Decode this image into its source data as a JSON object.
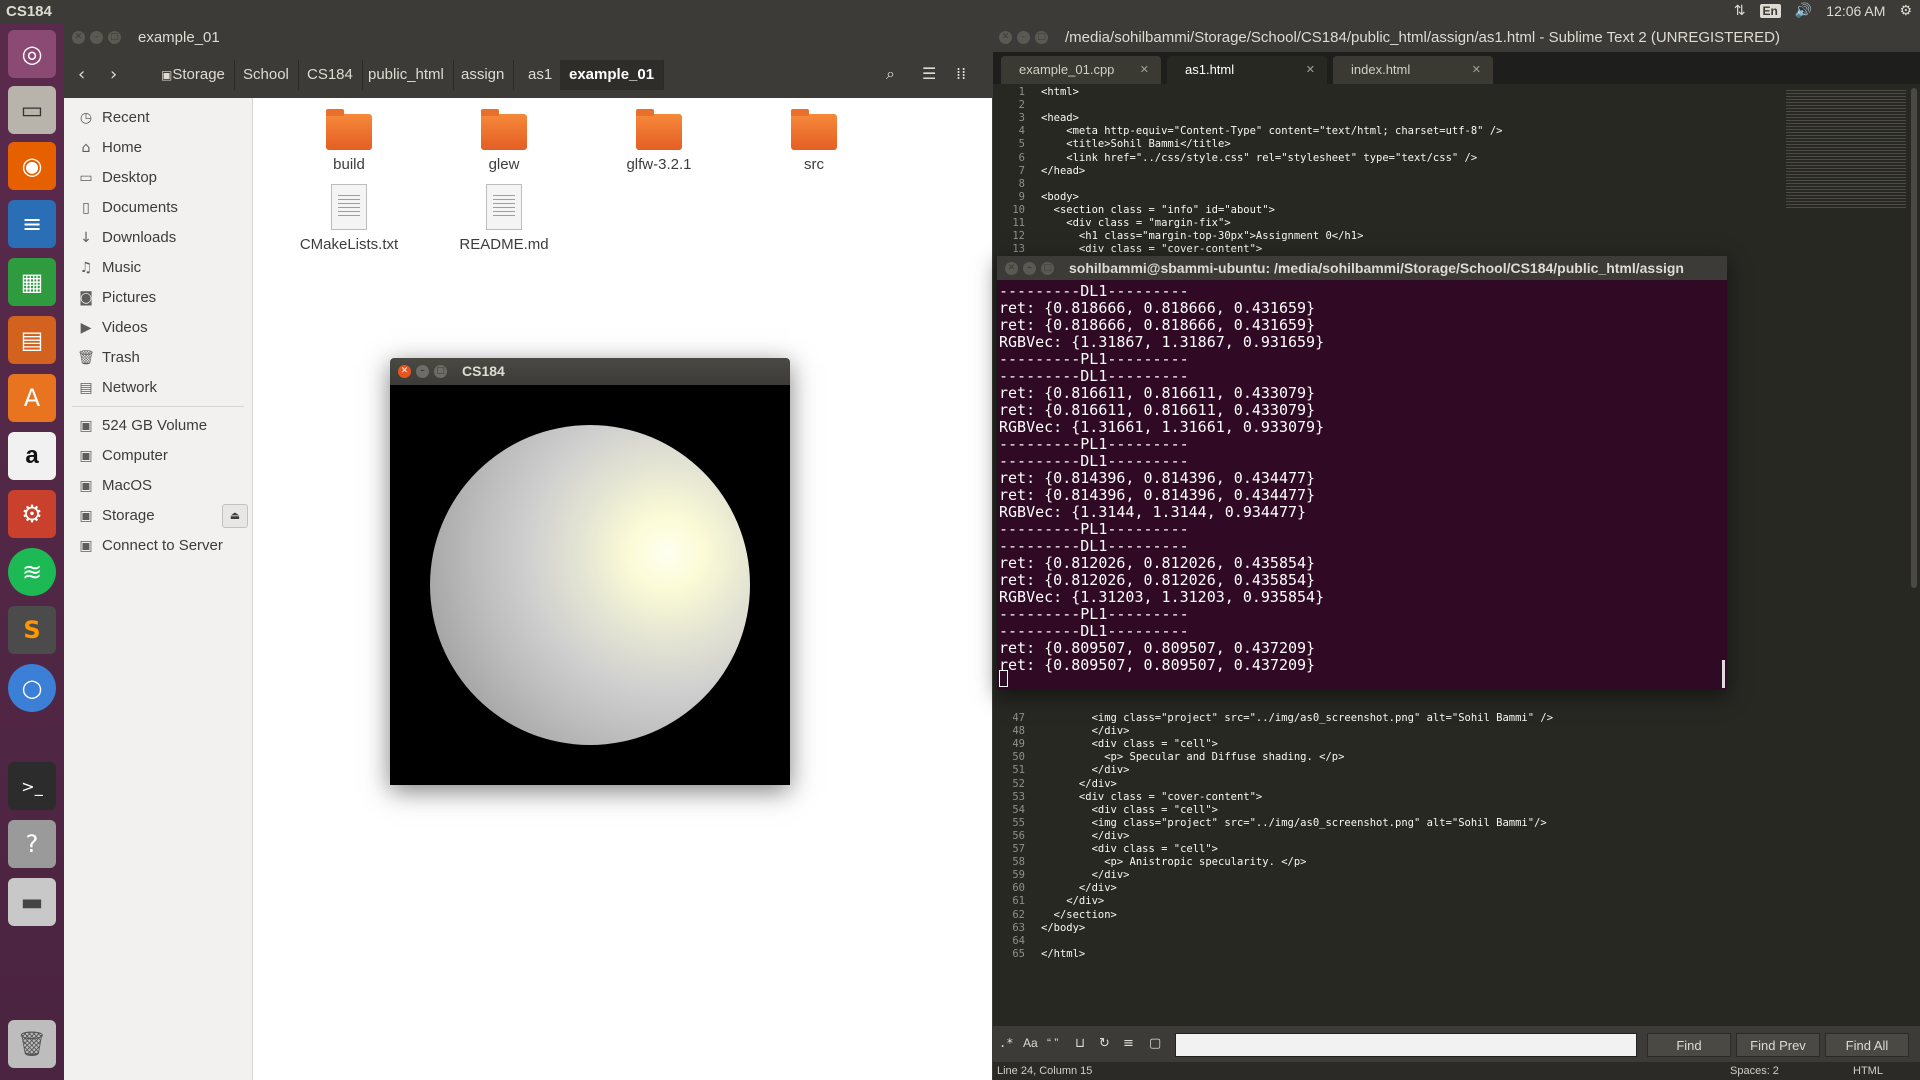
{
  "topbar": {
    "title": "CS184",
    "input_lang": "En",
    "time": "12:06 AM"
  },
  "launcher": {
    "items": [
      "dash-icon",
      "files-icon",
      "firefox-icon",
      "writer-icon",
      "calc-icon",
      "impress-icon",
      "software-center-icon",
      "amazon-icon",
      "settings-icon",
      "spotify-icon",
      "sublime-icon",
      "chromium-icon",
      "terminal-icon",
      "help-icon",
      "drive-icon",
      "trash-icon"
    ]
  },
  "files": {
    "title": "example_01",
    "breadcrumb": [
      "Storage",
      "School",
      "CS184",
      "public_html",
      "assign",
      "as1",
      "example_01"
    ],
    "sidebar": [
      {
        "icon": "recent-icon",
        "label": "Recent"
      },
      {
        "icon": "home-icon",
        "label": "Home"
      },
      {
        "icon": "desktop-icon",
        "label": "Desktop"
      },
      {
        "icon": "documents-icon",
        "label": "Documents"
      },
      {
        "icon": "downloads-icon",
        "label": "Downloads"
      },
      {
        "icon": "music-icon",
        "label": "Music"
      },
      {
        "icon": "pictures-icon",
        "label": "Pictures"
      },
      {
        "icon": "videos-icon",
        "label": "Videos"
      },
      {
        "icon": "trash-icon",
        "label": "Trash"
      },
      {
        "icon": "network-icon",
        "label": "Network"
      },
      {
        "icon": "drive-icon",
        "label": "524 GB Volume"
      },
      {
        "icon": "computer-icon",
        "label": "Computer"
      },
      {
        "icon": "drive-icon",
        "label": "MacOS"
      },
      {
        "icon": "drive-icon",
        "label": "Storage"
      },
      {
        "icon": "server-icon",
        "label": "Connect to Server"
      }
    ],
    "items": [
      {
        "type": "folder",
        "name": "build"
      },
      {
        "type": "folder",
        "name": "glew"
      },
      {
        "type": "folder",
        "name": "glfw-3.2.1"
      },
      {
        "type": "folder",
        "name": "src"
      },
      {
        "type": "file",
        "name": "CMakeLists.txt"
      },
      {
        "type": "file",
        "name": "README.md"
      }
    ]
  },
  "glwindow": {
    "title": "CS184"
  },
  "sublime": {
    "title": "/media/sohilbammi/Storage/School/CS184/public_html/assign/as1.html - Sublime Text 2 (UNREGISTERED)",
    "tabs": [
      "example_01.cpp",
      "as1.html",
      "index.html"
    ],
    "code_top": [
      {
        "n": "1",
        "t": "<html>"
      },
      {
        "n": "2",
        "t": ""
      },
      {
        "n": "3",
        "t": "<head>"
      },
      {
        "n": "4",
        "t": "    <meta http-equiv=\"Content-Type\" content=\"text/html; charset=utf-8\" />"
      },
      {
        "n": "5",
        "t": "    <title>Sohil Bammi</title>"
      },
      {
        "n": "6",
        "t": "    <link href=\"../css/style.css\" rel=\"stylesheet\" type=\"text/css\" />"
      },
      {
        "n": "7",
        "t": "</head>"
      },
      {
        "n": "8",
        "t": ""
      },
      {
        "n": "9",
        "t": "<body>"
      },
      {
        "n": "10",
        "t": "  <section class = \"info\" id=\"about\">"
      },
      {
        "n": "11",
        "t": "    <div class = \"margin-fix\">"
      },
      {
        "n": "12",
        "t": "      <h1 class=\"margin-top-30px\">Assignment 0</h1>"
      },
      {
        "n": "13",
        "t": "      <div class = \"cover-content\">"
      }
    ],
    "code_bottom": [
      {
        "n": "47",
        "t": "        <img class=\"project\" src=\"../img/as0_screenshot.png\" alt=\"Sohil Bammi\" />"
      },
      {
        "n": "48",
        "t": "        </div>"
      },
      {
        "n": "49",
        "t": "        <div class = \"cell\">"
      },
      {
        "n": "50",
        "t": "          <p> Specular and Diffuse shading. </p>"
      },
      {
        "n": "51",
        "t": "        </div>"
      },
      {
        "n": "52",
        "t": "      </div>"
      },
      {
        "n": "53",
        "t": "      <div class = \"cover-content\">"
      },
      {
        "n": "54",
        "t": "        <div class = \"cell\">"
      },
      {
        "n": "55",
        "t": "        <img class=\"project\" src=\"../img/as0_screenshot.png\" alt=\"Sohil Bammi\"/>"
      },
      {
        "n": "56",
        "t": "        </div>"
      },
      {
        "n": "57",
        "t": "        <div class = \"cell\">"
      },
      {
        "n": "58",
        "t": "          <p> Anistropic specularity. </p>"
      },
      {
        "n": "59",
        "t": "        </div>"
      },
      {
        "n": "60",
        "t": "      </div>"
      },
      {
        "n": "61",
        "t": "    </div>"
      },
      {
        "n": "62",
        "t": "  </section>"
      },
      {
        "n": "63",
        "t": "</body>"
      },
      {
        "n": "64",
        "t": ""
      },
      {
        "n": "65",
        "t": "</html>"
      }
    ],
    "find_buttons": [
      "Find",
      "Find Prev",
      "Find All"
    ],
    "status_left": "Line 24, Column 15",
    "status_spaces": "Spaces: 2",
    "status_syntax": "HTML"
  },
  "terminal": {
    "title": "sohilbammi@sbammi-ubuntu: /media/sohilbammi/Storage/School/CS184/public_html/assign",
    "lines": [
      "---------DL1---------",
      "ret: {0.818666, 0.818666, 0.431659}",
      "ret: {0.818666, 0.818666, 0.431659}",
      "RGBVec: {1.31867, 1.31867, 0.931659}",
      "---------PL1---------",
      "---------DL1---------",
      "ret: {0.816611, 0.816611, 0.433079}",
      "ret: {0.816611, 0.816611, 0.433079}",
      "RGBVec: {1.31661, 1.31661, 0.933079}",
      "---------PL1---------",
      "---------DL1---------",
      "ret: {0.814396, 0.814396, 0.434477}",
      "ret: {0.814396, 0.814396, 0.434477}",
      "RGBVec: {1.3144, 1.3144, 0.934477}",
      "---------PL1---------",
      "---------DL1---------",
      "ret: {0.812026, 0.812026, 0.435854}",
      "ret: {0.812026, 0.812026, 0.435854}",
      "RGBVec: {1.31203, 1.31203, 0.935854}",
      "---------PL1---------",
      "---------DL1---------",
      "ret: {0.809507, 0.809507, 0.437209}",
      "ret: {0.809507, 0.809507, 0.437209}"
    ]
  }
}
